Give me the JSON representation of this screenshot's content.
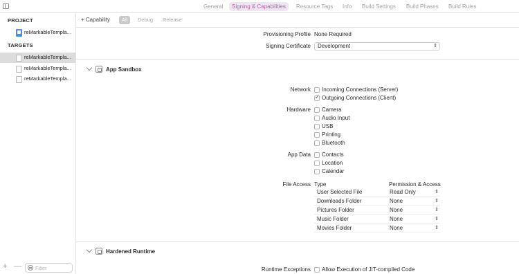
{
  "tabs": [
    {
      "label": "General",
      "active": false
    },
    {
      "label": "Signing & Capabilities",
      "active": true
    },
    {
      "label": "Resource Tags",
      "active": false
    },
    {
      "label": "Info",
      "active": false
    },
    {
      "label": "Build Settings",
      "active": false
    },
    {
      "label": "Build Phases",
      "active": false
    },
    {
      "label": "Build Rules",
      "active": false
    }
  ],
  "sidebar": {
    "project_header": "PROJECT",
    "project_item": "reMarkableTempla...",
    "targets_header": "TARGETS",
    "targets": [
      {
        "label": "reMarkableTempla...",
        "selected": true
      },
      {
        "label": "reMarkableTempla...",
        "selected": false
      },
      {
        "label": "reMarkableTempla...",
        "selected": false
      }
    ],
    "add_symbol": "+",
    "remove_symbol": "—",
    "filter_placeholder": "Filter"
  },
  "capbar": {
    "add_label": "+ Capability",
    "filters": [
      {
        "label": "All",
        "active": true
      },
      {
        "label": "Debug",
        "active": false
      },
      {
        "label": "Release",
        "active": false
      }
    ]
  },
  "signing": {
    "profile_label": "Provisioning Profile",
    "profile_value": "None Required",
    "certificate_label": "Signing Certificate",
    "certificate_value": "Development"
  },
  "sandbox": {
    "title": "App Sandbox",
    "network": {
      "label": "Network",
      "options": [
        {
          "label": "Incoming Connections (Server)",
          "checked": false
        },
        {
          "label": "Outgoing Connections (Client)",
          "checked": true
        }
      ]
    },
    "hardware": {
      "label": "Hardware",
      "options": [
        {
          "label": "Camera",
          "checked": false
        },
        {
          "label": "Audio Input",
          "checked": false
        },
        {
          "label": "USB",
          "checked": false
        },
        {
          "label": "Printing",
          "checked": false
        },
        {
          "label": "Bluetooth",
          "checked": false
        }
      ]
    },
    "app_data": {
      "label": "App Data",
      "options": [
        {
          "label": "Contacts",
          "checked": false
        },
        {
          "label": "Location",
          "checked": false
        },
        {
          "label": "Calendar",
          "checked": false
        }
      ]
    },
    "file_access": {
      "label": "File Access",
      "type_header": "Type",
      "perm_header": "Permission & Access",
      "rows": [
        {
          "type": "User Selected File",
          "permission": "Read Only"
        },
        {
          "type": "Downloads Folder",
          "permission": "None"
        },
        {
          "type": "Pictures Folder",
          "permission": "None"
        },
        {
          "type": "Music Folder",
          "permission": "None"
        },
        {
          "type": "Movies Folder",
          "permission": "None"
        }
      ]
    }
  },
  "hardened_runtime": {
    "title": "Hardened Runtime",
    "exceptions_label": "Runtime Exceptions",
    "exceptions_option": "Allow Execution of JIT-compiled Code",
    "exceptions_checked": false
  },
  "colors": {
    "active_tab_bg": "#f0e6f3",
    "active_tab_text": "#b6649f",
    "selection_bg": "#dcdcdc"
  }
}
